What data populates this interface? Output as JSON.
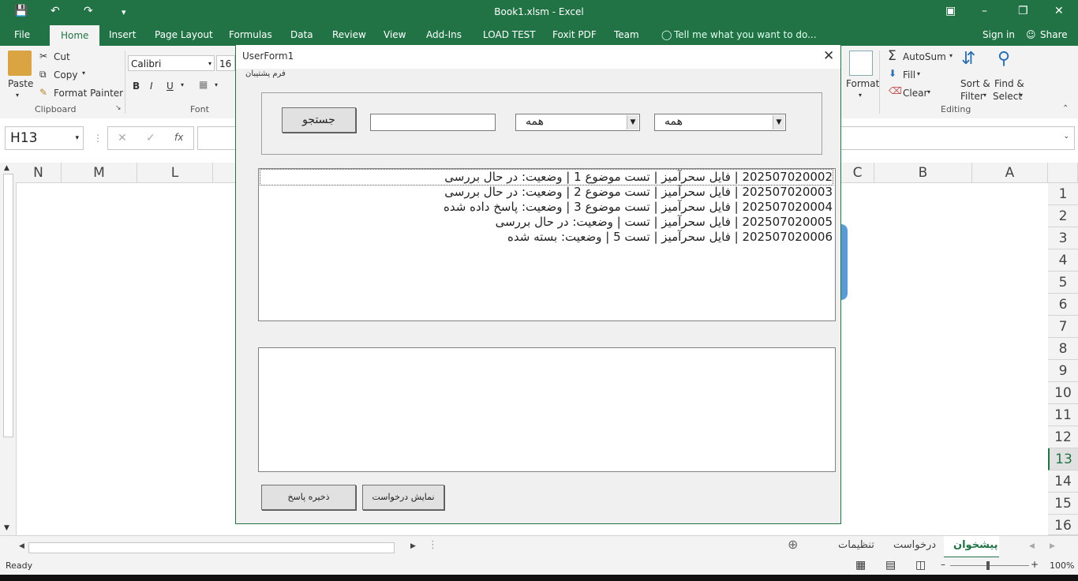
{
  "window": {
    "title": "Book1.xlsm - Excel"
  },
  "ribbon_tabs": [
    "File",
    "Home",
    "Insert",
    "Page Layout",
    "Formulas",
    "Data",
    "Review",
    "View",
    "Add-Ins",
    "LOAD TEST",
    "Foxit PDF",
    "Team"
  ],
  "tell_me": "Tell me what you want to do...",
  "account": {
    "sign_in": "Sign in",
    "share": "Share"
  },
  "clipboard": {
    "paste": "Paste",
    "cut": "Cut",
    "copy": "Copy",
    "format_painter": "Format Painter",
    "group": "Clipboard"
  },
  "font": {
    "name": "Calibri",
    "size": "16",
    "bold": "B",
    "italic": "I",
    "underline": "U",
    "group": "Font"
  },
  "cells_group": {
    "format": "Format"
  },
  "editing": {
    "autosum": "AutoSum",
    "fill": "Fill",
    "clear": "Clear",
    "sort": "Sort &",
    "sort2": "Filter",
    "find": "Find &",
    "find2": "Select",
    "group": "Editing"
  },
  "namebox": "H13",
  "fx": "fx",
  "columns": [
    "N",
    "M",
    "L",
    "C",
    "B",
    "A"
  ],
  "rows": [
    "1",
    "2",
    "3",
    "4",
    "5",
    "6",
    "7",
    "8",
    "9",
    "10",
    "11",
    "12",
    "13",
    "14",
    "15",
    "16"
  ],
  "sheets": [
    "پیشخوان",
    "درخواست",
    "تنظیمات"
  ],
  "status": {
    "ready": "Ready",
    "zoom": "100%"
  },
  "form": {
    "title": "UserForm1",
    "caption": "فرم پشتیبان",
    "search_button": "جستجو",
    "search_value": "",
    "filter1": "همه",
    "filter2": "همه",
    "list": [
      "202507020002 | فایل سحرآمیز | تست موضوع 1 | وضعیت: در حال بررسی",
      "202507020003 | فایل سحرآمیز | تست موضوع 2 | وضعیت: در حال بررسی",
      "202507020004 | فایل سحرآمیز | تست موضوع 3 | وضعیت: پاسخ داده شده",
      "202507020005 | فایل سحرآمیز | تست | وضعیت: در حال بررسی",
      "202507020006 | فایل سحرآمیز | تست 5 | وضعیت: بسته شده"
    ],
    "show_request": "نمایش درخواست",
    "save_reply": "ذخیره پاسخ"
  }
}
